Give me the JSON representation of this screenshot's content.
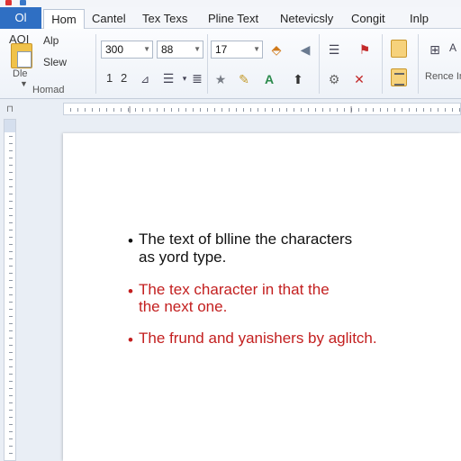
{
  "ribbon_tabs": [
    "Ol",
    "Hom",
    "Cantel",
    "Tex Texs",
    "Pline Text",
    "Netevicsly",
    "Congit",
    "Inlp"
  ],
  "clipboard": {
    "label_top": "AQI",
    "label_mid": "Dle",
    "format": "Alp",
    "slew": "Slew",
    "group_name": "Homad"
  },
  "font": {
    "name": "300",
    "size": "88",
    "line1_a": "1",
    "line1_b": "2"
  },
  "paragraph": {
    "size": "17"
  },
  "editing": {
    "replace": "Rence In"
  },
  "document": {
    "paragraphs": [
      {
        "lines": [
          "The text of blline the characters",
          "as yord type."
        ],
        "color": "black"
      },
      {
        "lines": [
          "The tex character in that the",
          "the next one."
        ],
        "color": "red"
      },
      {
        "lines": [
          "The frund and yanishers by aglitch."
        ],
        "color": "red"
      }
    ]
  },
  "colors": {
    "file_tab": "#2f6fc3",
    "red_text": "#c31f1f"
  }
}
